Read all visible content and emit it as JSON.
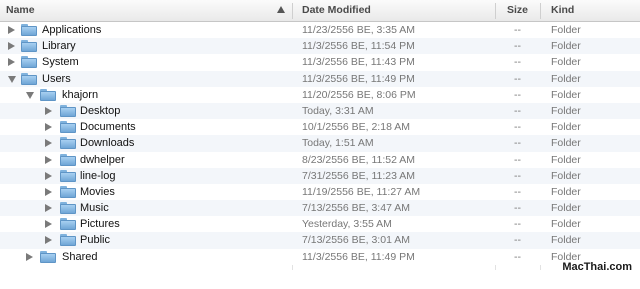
{
  "columns": {
    "name": "Name",
    "date_modified": "Date Modified",
    "size": "Size",
    "kind": "Kind"
  },
  "rows": [
    {
      "name": "Applications",
      "date": "11/23/2556 BE, 3:35 AM",
      "size": "--",
      "kind": "Folder",
      "level": 0,
      "expanded": false
    },
    {
      "name": "Library",
      "date": "11/3/2556 BE, 11:54 PM",
      "size": "--",
      "kind": "Folder",
      "level": 0,
      "expanded": false
    },
    {
      "name": "System",
      "date": "11/3/2556 BE, 11:43 PM",
      "size": "--",
      "kind": "Folder",
      "level": 0,
      "expanded": false
    },
    {
      "name": "Users",
      "date": "11/3/2556 BE, 11:49 PM",
      "size": "--",
      "kind": "Folder",
      "level": 0,
      "expanded": true
    },
    {
      "name": "khajorn",
      "date": "11/20/2556 BE, 8:06 PM",
      "size": "--",
      "kind": "Folder",
      "level": 1,
      "expanded": true
    },
    {
      "name": "Desktop",
      "date": "Today, 3:31 AM",
      "size": "--",
      "kind": "Folder",
      "level": 2,
      "expanded": false
    },
    {
      "name": "Documents",
      "date": "10/1/2556 BE, 2:18 AM",
      "size": "--",
      "kind": "Folder",
      "level": 2,
      "expanded": false
    },
    {
      "name": "Downloads",
      "date": "Today, 1:51 AM",
      "size": "--",
      "kind": "Folder",
      "level": 2,
      "expanded": false
    },
    {
      "name": "dwhelper",
      "date": "8/23/2556 BE, 11:52 AM",
      "size": "--",
      "kind": "Folder",
      "level": 2,
      "expanded": false
    },
    {
      "name": "line-log",
      "date": "7/31/2556 BE, 11:23 AM",
      "size": "--",
      "kind": "Folder",
      "level": 2,
      "expanded": false
    },
    {
      "name": "Movies",
      "date": "11/19/2556 BE, 11:27 AM",
      "size": "--",
      "kind": "Folder",
      "level": 2,
      "expanded": false
    },
    {
      "name": "Music",
      "date": "7/13/2556 BE, 3:47 AM",
      "size": "--",
      "kind": "Folder",
      "level": 2,
      "expanded": false
    },
    {
      "name": "Pictures",
      "date": "Yesterday, 3:55 AM",
      "size": "--",
      "kind": "Folder",
      "level": 2,
      "expanded": false
    },
    {
      "name": "Public",
      "date": "7/13/2556 BE, 3:01 AM",
      "size": "--",
      "kind": "Folder",
      "level": 2,
      "expanded": false
    },
    {
      "name": "Shared",
      "date": "11/3/2556 BE, 11:49 PM",
      "size": "--",
      "kind": "Folder",
      "level": 1,
      "expanded": false
    }
  ],
  "watermark": "MacThai.com"
}
